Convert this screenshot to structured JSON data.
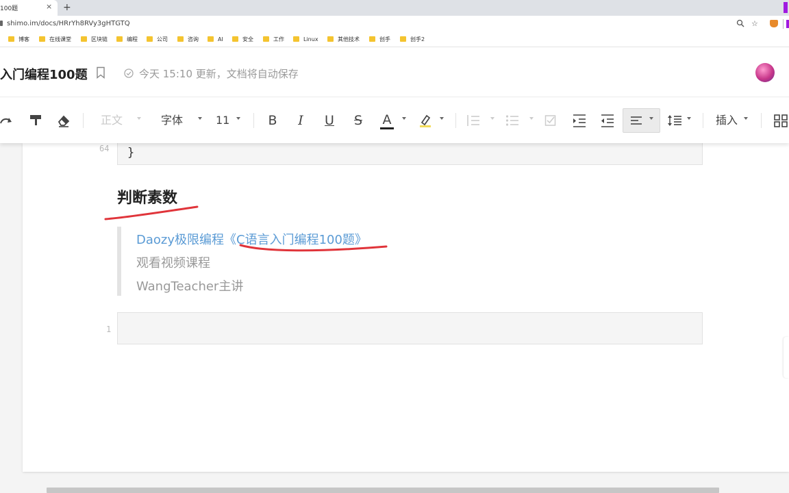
{
  "browser": {
    "tab_title": "100题",
    "tab_close": "×",
    "new_tab": "+",
    "url": "shimo.im/docs/HRrYh8RVy3gHTGTQ",
    "bookmarks": [
      "博客",
      "在线课堂",
      "区块链",
      "编程",
      "公司",
      "咨询",
      "AI",
      "安全",
      "工作",
      "Linux",
      "其他技术",
      "创手",
      "创手2"
    ]
  },
  "doc": {
    "title": "入门编程100题",
    "save_status": "今天 15:10 更新，文档将自动保存"
  },
  "toolbar": {
    "style_label": "正文",
    "font_label": "字体",
    "size_label": "11",
    "bold": "B",
    "italic": "I",
    "underline": "U",
    "strike": "S",
    "font_color": "A",
    "insert_label": "插入"
  },
  "content": {
    "top_line_number": "64",
    "top_code": "}",
    "heading": "判断素数",
    "quote_lines": [
      "Daozy极限编程《C语言入门编程100题》",
      "观看视频课程",
      "WangTeacher主讲"
    ],
    "bottom_line_number": "1"
  },
  "colors": {
    "link": "#5b9bd5",
    "annotation_ink": "#e0343a",
    "accent_purple": "#a01ae0"
  }
}
